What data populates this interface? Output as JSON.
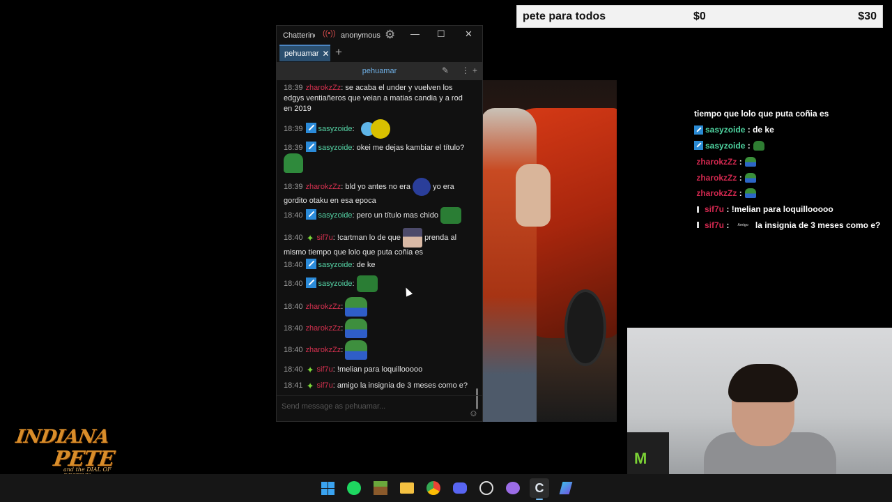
{
  "goal": {
    "title": "pete para todos",
    "current": "$0",
    "target": "$30"
  },
  "overlay": {
    "lines": [
      {
        "name": "",
        "text": "tiempo que lolo que puta coñia es"
      },
      {
        "name": "sasyzoide",
        "text": "de ke"
      },
      {
        "name": "sasyzoide",
        "text": ""
      },
      {
        "name": "zharokzZz",
        "text": ""
      },
      {
        "name": "zharokzZz",
        "text": ""
      },
      {
        "name": "zharokzZz",
        "text": ""
      },
      {
        "name": "sif7u",
        "text": "!melian para loquillooooo"
      },
      {
        "name": "sif7u",
        "text": "la insignia de 3 meses como e?",
        "emote_text": "Amigo"
      }
    ],
    "separator": ":"
  },
  "chatterino": {
    "app_title": "Chatterino",
    "live_icon": "live-icon",
    "account": "anonymous",
    "tab_label": "pehuamar",
    "channel_name": "pehuamar",
    "input_placeholder": "Send message as pehuamar...",
    "messages": [
      {
        "ts": "18:39",
        "user": "zharokzZz",
        "text": "se acaba el under y vuelven los edgys ventiañeros que veian a matias candia y a rod en 2019"
      },
      {
        "ts": "18:39",
        "user": "sasyzoide",
        "text": ""
      },
      {
        "ts": "18:39",
        "user": "sasyzoide",
        "text": "okei me dejas kambiar el título?"
      },
      {
        "ts": "18:39",
        "user": "zharokzZz",
        "text": "bld yo antes no era",
        "text2": "yo era gordito otaku en esa epoca"
      },
      {
        "ts": "18:40",
        "user": "sasyzoide",
        "text": "pero un título mas chido"
      },
      {
        "ts": "18:40",
        "user": "sif7u",
        "text": "!cartman lo de que",
        "text2": "prenda al mismo tiempo que lolo que puta coñia es"
      },
      {
        "ts": "18:40",
        "user": "sasyzoide",
        "text": "de ke"
      },
      {
        "ts": "18:40",
        "user": "sasyzoide",
        "text": ""
      },
      {
        "ts": "18:40",
        "user": "zharokzZz",
        "text": ""
      },
      {
        "ts": "18:40",
        "user": "zharokzZz",
        "text": ""
      },
      {
        "ts": "18:40",
        "user": "zharokzZz",
        "text": ""
      },
      {
        "ts": "18:40",
        "user": "sif7u",
        "text": "!melian para loquillooooo"
      },
      {
        "ts": "18:41",
        "user": "sif7u",
        "text": "amigo la insignia de 3 meses como e?"
      }
    ]
  },
  "logo": {
    "line1": "INDIANA",
    "line2": "PETE",
    "line3": "and the DIAL OF DESTINY"
  },
  "taskbar": {
    "icons": [
      "windows-start-icon",
      "spotify-icon",
      "minecraft-icon",
      "file-explorer-icon",
      "chrome-icon",
      "discord-icon",
      "obs-icon",
      "chat-app-icon",
      "chatterino-icon",
      "streamlabs-icon"
    ]
  },
  "colors": {
    "mod_badge": "#2b8bd9",
    "name_green": "#55d4a6",
    "name_red": "#d83150",
    "tab_blue": "#2b4f6f"
  }
}
